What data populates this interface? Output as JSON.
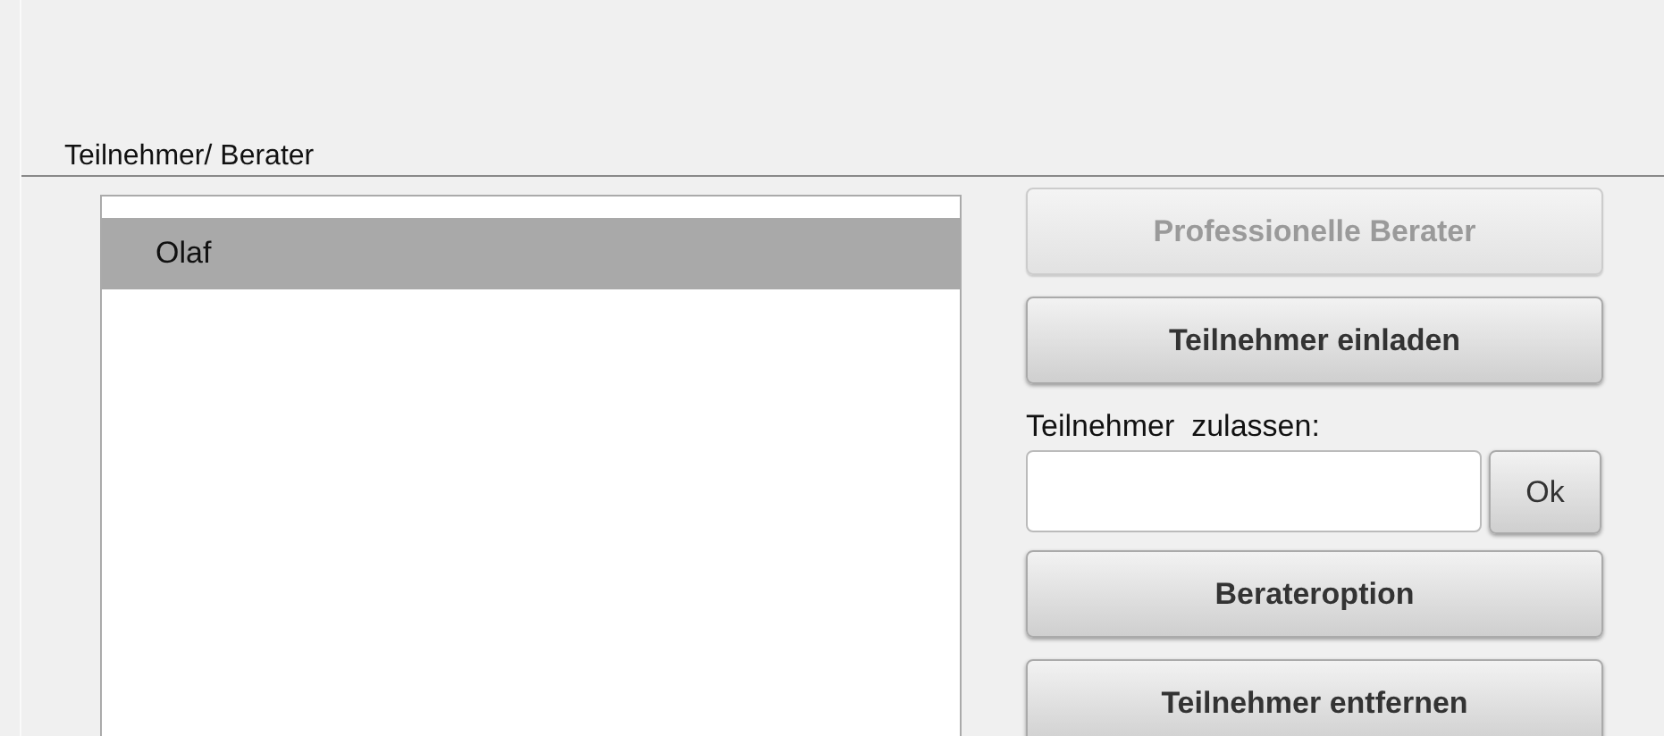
{
  "section": {
    "title": "Teilnehmer/ Berater"
  },
  "participants": [
    {
      "name": "Olaf",
      "selected": true
    }
  ],
  "actions": [
    {
      "kind": "button",
      "label": "Professionelle Berater",
      "disabled": true
    },
    {
      "kind": "button",
      "label": "Teilnehmer einladen",
      "disabled": false
    },
    {
      "kind": "admit",
      "label": "Teilnehmer  zulassen:",
      "button": "Ok"
    },
    {
      "kind": "button",
      "label": "Berateroption",
      "disabled": false
    },
    {
      "kind": "button",
      "label": "Teilnehmer entfernen",
      "disabled": false
    }
  ]
}
